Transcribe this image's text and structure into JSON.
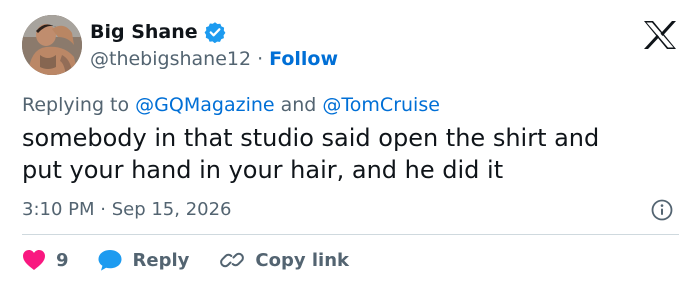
{
  "author": {
    "display_name": "Big Shane",
    "handle": "@thebigshane12",
    "separator": "·",
    "follow_label": "Follow"
  },
  "reply_context": {
    "prefix": "Replying to",
    "mention_1": "@GQMagazine",
    "conjunction": "and",
    "mention_2": "@TomCruise"
  },
  "tweet": {
    "line_1": "somebody in that studio said open the shirt and",
    "line_2": "put your hand in your hair, and he did it"
  },
  "meta": {
    "timestamp": "3:10 PM · Sep 15, 2026"
  },
  "actions": {
    "like_count": "9",
    "reply_label": "Reply",
    "copy_link_label": "Copy link"
  },
  "colors": {
    "link": "#006fd6",
    "like": "#f91880",
    "reply": "#1d9bf0",
    "muted": "#536471",
    "text": "#0f1419"
  },
  "icons": [
    "verified-badge-icon",
    "x-logo-icon",
    "info-icon",
    "heart-icon",
    "reply-bubble-icon",
    "link-icon"
  ]
}
